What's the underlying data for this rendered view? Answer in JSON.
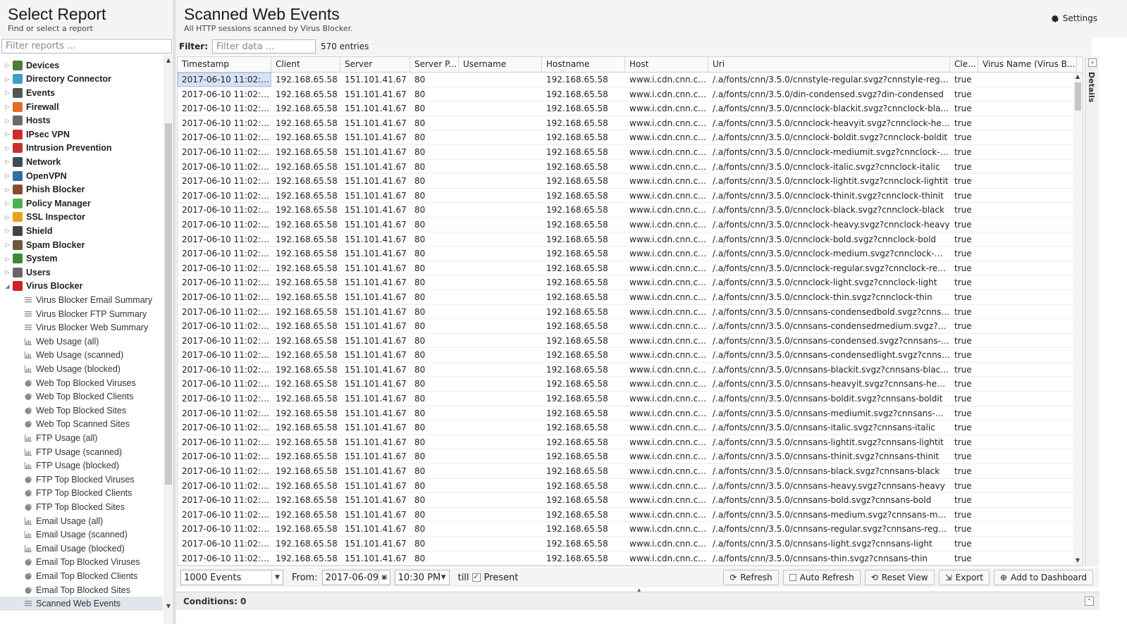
{
  "left": {
    "title": "Select Report",
    "subtitle": "Find or select a report",
    "filter_placeholder": "Filter reports ...",
    "tree": [
      {
        "label": "Devices",
        "type": "category",
        "expanded": false,
        "color": "#4a7d3a"
      },
      {
        "label": "Directory Connector",
        "type": "category",
        "expanded": false,
        "color": "#3aa0c8"
      },
      {
        "label": "Events",
        "type": "category",
        "expanded": false,
        "color": "#555555"
      },
      {
        "label": "Firewall",
        "type": "category",
        "expanded": false,
        "color": "#e26b2a"
      },
      {
        "label": "Hosts",
        "type": "category",
        "expanded": false,
        "color": "#6a6a6a"
      },
      {
        "label": "IPsec VPN",
        "type": "category",
        "expanded": false,
        "color": "#d22b2b"
      },
      {
        "label": "Intrusion Prevention",
        "type": "category",
        "expanded": false,
        "color": "#c8322a"
      },
      {
        "label": "Network",
        "type": "category",
        "expanded": false,
        "color": "#3c4c5c"
      },
      {
        "label": "OpenVPN",
        "type": "category",
        "expanded": false,
        "color": "#2f6fa0"
      },
      {
        "label": "Phish Blocker",
        "type": "category",
        "expanded": false,
        "color": "#8a4a2a"
      },
      {
        "label": "Policy Manager",
        "type": "category",
        "expanded": false,
        "color": "#4caf50"
      },
      {
        "label": "SSL Inspector",
        "type": "category",
        "expanded": false,
        "color": "#e8a020"
      },
      {
        "label": "Shield",
        "type": "category",
        "expanded": false,
        "color": "#444444"
      },
      {
        "label": "Spam Blocker",
        "type": "category",
        "expanded": false,
        "color": "#6d5a3a"
      },
      {
        "label": "System",
        "type": "category",
        "expanded": false,
        "color": "#3a8a3a"
      },
      {
        "label": "Users",
        "type": "category",
        "expanded": false,
        "color": "#666666"
      },
      {
        "label": "Virus Blocker",
        "type": "category",
        "expanded": true,
        "color": "#d0202a"
      },
      {
        "label": "Virus Blocker Email Summary",
        "type": "text"
      },
      {
        "label": "Virus Blocker FTP Summary",
        "type": "text"
      },
      {
        "label": "Virus Blocker Web Summary",
        "type": "text"
      },
      {
        "label": "Web Usage (all)",
        "type": "bar"
      },
      {
        "label": "Web Usage (scanned)",
        "type": "bar"
      },
      {
        "label": "Web Usage (blocked)",
        "type": "bar"
      },
      {
        "label": "Web Top Blocked Viruses",
        "type": "pie"
      },
      {
        "label": "Web Top Blocked Clients",
        "type": "pie"
      },
      {
        "label": "Web Top Blocked Sites",
        "type": "pie"
      },
      {
        "label": "Web Top Scanned Sites",
        "type": "pie"
      },
      {
        "label": "FTP Usage (all)",
        "type": "bar"
      },
      {
        "label": "FTP Usage (scanned)",
        "type": "bar"
      },
      {
        "label": "FTP Usage (blocked)",
        "type": "bar"
      },
      {
        "label": "FTP Top Blocked Viruses",
        "type": "pie"
      },
      {
        "label": "FTP Top Blocked Clients",
        "type": "pie"
      },
      {
        "label": "FTP Top Blocked Sites",
        "type": "pie"
      },
      {
        "label": "Email Usage (all)",
        "type": "bar"
      },
      {
        "label": "Email Usage (scanned)",
        "type": "bar"
      },
      {
        "label": "Email Usage (blocked)",
        "type": "bar"
      },
      {
        "label": "Email Top Blocked Viruses",
        "type": "pie"
      },
      {
        "label": "Email Top Blocked Clients",
        "type": "pie"
      },
      {
        "label": "Email Top Blocked Sites",
        "type": "pie"
      },
      {
        "label": "Scanned Web Events",
        "type": "list",
        "selected": true
      }
    ]
  },
  "main": {
    "title": "Scanned Web Events",
    "subtitle": "All HTTP sessions scanned by Virus Blocker.",
    "settings_label": "Settings",
    "filter_label": "Filter:",
    "filter_placeholder": "Filter data ...",
    "entries": "570 entries",
    "details_label": "Details"
  },
  "grid": {
    "columns": [
      "Timestamp",
      "Client",
      "Server",
      "Server P...",
      "Username",
      "Hostname",
      "Host",
      "Uri",
      "Cle...",
      "Virus Name (Virus B..."
    ],
    "rows": [
      [
        "2017-06-10 11:02:5...",
        "192.168.65.58",
        "151.101.41.67",
        "80",
        "",
        "192.168.65.58",
        "www.i.cdn.cnn.co...",
        "/.a/fonts/cnn/3.5.0/cnnstyle-regular.svgz?cnnstyle-regular",
        "true",
        ""
      ],
      [
        "2017-06-10 11:02:5...",
        "192.168.65.58",
        "151.101.41.67",
        "80",
        "",
        "192.168.65.58",
        "www.i.cdn.cnn.co...",
        "/.a/fonts/cnn/3.5.0/din-condensed.svgz?din-condensed",
        "true",
        ""
      ],
      [
        "2017-06-10 11:02:5...",
        "192.168.65.58",
        "151.101.41.67",
        "80",
        "",
        "192.168.65.58",
        "www.i.cdn.cnn.co...",
        "/.a/fonts/cnn/3.5.0/cnnclock-blackit.svgz?cnnclock-blackit",
        "true",
        ""
      ],
      [
        "2017-06-10 11:02:5...",
        "192.168.65.58",
        "151.101.41.67",
        "80",
        "",
        "192.168.65.58",
        "www.i.cdn.cnn.co...",
        "/.a/fonts/cnn/3.5.0/cnnclock-heavyit.svgz?cnnclock-heavyit",
        "true",
        ""
      ],
      [
        "2017-06-10 11:02:5...",
        "192.168.65.58",
        "151.101.41.67",
        "80",
        "",
        "192.168.65.58",
        "www.i.cdn.cnn.co...",
        "/.a/fonts/cnn/3.5.0/cnnclock-boldit.svgz?cnnclock-boldit",
        "true",
        ""
      ],
      [
        "2017-06-10 11:02:5...",
        "192.168.65.58",
        "151.101.41.67",
        "80",
        "",
        "192.168.65.58",
        "www.i.cdn.cnn.co...",
        "/.a/fonts/cnn/3.5.0/cnnclock-mediumit.svgz?cnnclock-med...",
        "true",
        ""
      ],
      [
        "2017-06-10 11:02:5...",
        "192.168.65.58",
        "151.101.41.67",
        "80",
        "",
        "192.168.65.58",
        "www.i.cdn.cnn.co...",
        "/.a/fonts/cnn/3.5.0/cnnclock-italic.svgz?cnnclock-italic",
        "true",
        ""
      ],
      [
        "2017-06-10 11:02:5...",
        "192.168.65.58",
        "151.101.41.67",
        "80",
        "",
        "192.168.65.58",
        "www.i.cdn.cnn.co...",
        "/.a/fonts/cnn/3.5.0/cnnclock-lightit.svgz?cnnclock-lightit",
        "true",
        ""
      ],
      [
        "2017-06-10 11:02:5...",
        "192.168.65.58",
        "151.101.41.67",
        "80",
        "",
        "192.168.65.58",
        "www.i.cdn.cnn.co...",
        "/.a/fonts/cnn/3.5.0/cnnclock-thinit.svgz?cnnclock-thinit",
        "true",
        ""
      ],
      [
        "2017-06-10 11:02:5...",
        "192.168.65.58",
        "151.101.41.67",
        "80",
        "",
        "192.168.65.58",
        "www.i.cdn.cnn.co...",
        "/.a/fonts/cnn/3.5.0/cnnclock-black.svgz?cnnclock-black",
        "true",
        ""
      ],
      [
        "2017-06-10 11:02:5...",
        "192.168.65.58",
        "151.101.41.67",
        "80",
        "",
        "192.168.65.58",
        "www.i.cdn.cnn.co...",
        "/.a/fonts/cnn/3.5.0/cnnclock-heavy.svgz?cnnclock-heavy",
        "true",
        ""
      ],
      [
        "2017-06-10 11:02:5...",
        "192.168.65.58",
        "151.101.41.67",
        "80",
        "",
        "192.168.65.58",
        "www.i.cdn.cnn.co...",
        "/.a/fonts/cnn/3.5.0/cnnclock-bold.svgz?cnnclock-bold",
        "true",
        ""
      ],
      [
        "2017-06-10 11:02:5...",
        "192.168.65.58",
        "151.101.41.67",
        "80",
        "",
        "192.168.65.58",
        "www.i.cdn.cnn.co...",
        "/.a/fonts/cnn/3.5.0/cnnclock-medium.svgz?cnnclock-mediu...",
        "true",
        ""
      ],
      [
        "2017-06-10 11:02:5...",
        "192.168.65.58",
        "151.101.41.67",
        "80",
        "",
        "192.168.65.58",
        "www.i.cdn.cnn.co...",
        "/.a/fonts/cnn/3.5.0/cnnclock-regular.svgz?cnnclock-regular",
        "true",
        ""
      ],
      [
        "2017-06-10 11:02:5...",
        "192.168.65.58",
        "151.101.41.67",
        "80",
        "",
        "192.168.65.58",
        "www.i.cdn.cnn.co...",
        "/.a/fonts/cnn/3.5.0/cnnclock-light.svgz?cnnclock-light",
        "true",
        ""
      ],
      [
        "2017-06-10 11:02:5...",
        "192.168.65.58",
        "151.101.41.67",
        "80",
        "",
        "192.168.65.58",
        "www.i.cdn.cnn.co...",
        "/.a/fonts/cnn/3.5.0/cnnclock-thin.svgz?cnnclock-thin",
        "true",
        ""
      ],
      [
        "2017-06-10 11:02:5...",
        "192.168.65.58",
        "151.101.41.67",
        "80",
        "",
        "192.168.65.58",
        "www.i.cdn.cnn.co...",
        "/.a/fonts/cnn/3.5.0/cnnsans-condensedbold.svgz?cnnsans...",
        "true",
        ""
      ],
      [
        "2017-06-10 11:02:4...",
        "192.168.65.58",
        "151.101.41.67",
        "80",
        "",
        "192.168.65.58",
        "www.i.cdn.cnn.co...",
        "/.a/fonts/cnn/3.5.0/cnnsans-condensedmedium.svgz?cnn...",
        "true",
        ""
      ],
      [
        "2017-06-10 11:02:4...",
        "192.168.65.58",
        "151.101.41.67",
        "80",
        "",
        "192.168.65.58",
        "www.i.cdn.cnn.co...",
        "/.a/fonts/cnn/3.5.0/cnnsans-condensed.svgz?cnnsans-con...",
        "true",
        ""
      ],
      [
        "2017-06-10 11:02:4...",
        "192.168.65.58",
        "151.101.41.67",
        "80",
        "",
        "192.168.65.58",
        "www.i.cdn.cnn.co...",
        "/.a/fonts/cnn/3.5.0/cnnsans-condensedlight.svgz?cnnsans-...",
        "true",
        ""
      ],
      [
        "2017-06-10 11:02:4...",
        "192.168.65.58",
        "151.101.41.67",
        "80",
        "",
        "192.168.65.58",
        "www.i.cdn.cnn.co...",
        "/.a/fonts/cnn/3.5.0/cnnsans-blackit.svgz?cnnsans-blackit",
        "true",
        ""
      ],
      [
        "2017-06-10 11:02:4...",
        "192.168.65.58",
        "151.101.41.67",
        "80",
        "",
        "192.168.65.58",
        "www.i.cdn.cnn.co...",
        "/.a/fonts/cnn/3.5.0/cnnsans-heavyit.svgz?cnnsans-heavyit",
        "true",
        ""
      ],
      [
        "2017-06-10 11:02:4...",
        "192.168.65.58",
        "151.101.41.67",
        "80",
        "",
        "192.168.65.58",
        "www.i.cdn.cnn.co...",
        "/.a/fonts/cnn/3.5.0/cnnsans-boldit.svgz?cnnsans-boldit",
        "true",
        ""
      ],
      [
        "2017-06-10 11:02:4...",
        "192.168.65.58",
        "151.101.41.67",
        "80",
        "",
        "192.168.65.58",
        "www.i.cdn.cnn.co...",
        "/.a/fonts/cnn/3.5.0/cnnsans-mediumit.svgz?cnnsans-med...",
        "true",
        ""
      ],
      [
        "2017-06-10 11:02:4...",
        "192.168.65.58",
        "151.101.41.67",
        "80",
        "",
        "192.168.65.58",
        "www.i.cdn.cnn.co...",
        "/.a/fonts/cnn/3.5.0/cnnsans-italic.svgz?cnnsans-italic",
        "true",
        ""
      ],
      [
        "2017-06-10 11:02:4...",
        "192.168.65.58",
        "151.101.41.67",
        "80",
        "",
        "192.168.65.58",
        "www.i.cdn.cnn.co...",
        "/.a/fonts/cnn/3.5.0/cnnsans-lightit.svgz?cnnsans-lightit",
        "true",
        ""
      ],
      [
        "2017-06-10 11:02:4...",
        "192.168.65.58",
        "151.101.41.67",
        "80",
        "",
        "192.168.65.58",
        "www.i.cdn.cnn.co...",
        "/.a/fonts/cnn/3.5.0/cnnsans-thinit.svgz?cnnsans-thinit",
        "true",
        ""
      ],
      [
        "2017-06-10 11:02:4...",
        "192.168.65.58",
        "151.101.41.67",
        "80",
        "",
        "192.168.65.58",
        "www.i.cdn.cnn.co...",
        "/.a/fonts/cnn/3.5.0/cnnsans-black.svgz?cnnsans-black",
        "true",
        ""
      ],
      [
        "2017-06-10 11:02:4...",
        "192.168.65.58",
        "151.101.41.67",
        "80",
        "",
        "192.168.65.58",
        "www.i.cdn.cnn.co...",
        "/.a/fonts/cnn/3.5.0/cnnsans-heavy.svgz?cnnsans-heavy",
        "true",
        ""
      ],
      [
        "2017-06-10 11:02:4...",
        "192.168.65.58",
        "151.101.41.67",
        "80",
        "",
        "192.168.65.58",
        "www.i.cdn.cnn.co...",
        "/.a/fonts/cnn/3.5.0/cnnsans-bold.svgz?cnnsans-bold",
        "true",
        ""
      ],
      [
        "2017-06-10 11:02:4...",
        "192.168.65.58",
        "151.101.41.67",
        "80",
        "",
        "192.168.65.58",
        "www.i.cdn.cnn.co...",
        "/.a/fonts/cnn/3.5.0/cnnsans-medium.svgz?cnnsans-mediu...",
        "true",
        ""
      ],
      [
        "2017-06-10 11:02:4...",
        "192.168.65.58",
        "151.101.41.67",
        "80",
        "",
        "192.168.65.58",
        "www.i.cdn.cnn.co...",
        "/.a/fonts/cnn/3.5.0/cnnsans-regular.svgz?cnnsans-regular",
        "true",
        ""
      ],
      [
        "2017-06-10 11:02:4...",
        "192.168.65.58",
        "151.101.41.67",
        "80",
        "",
        "192.168.65.58",
        "www.i.cdn.cnn.co...",
        "/.a/fonts/cnn/3.5.0/cnnsans-light.svgz?cnnsans-light",
        "true",
        ""
      ],
      [
        "2017-06-10 11:02:4...",
        "192.168.65.58",
        "151.101.41.67",
        "80",
        "",
        "192.168.65.58",
        "www.i.cdn.cnn.co...",
        "/.a/fonts/cnn/3.5.0/cnnsans-thin.svgz?cnnsans-thin",
        "true",
        ""
      ]
    ]
  },
  "toolbar": {
    "events_select": "1000 Events",
    "from_label": "From:",
    "from_date": "2017-06-09",
    "from_time": "10:30 PM",
    "till_label": "till",
    "present_label": "Present",
    "present_checked": true,
    "refresh_label": "Refresh",
    "auto_refresh_label": "Auto Refresh",
    "reset_view_label": "Reset View",
    "export_label": "Export",
    "add_dashboard_label": "Add to Dashboard"
  },
  "conditions": {
    "label": "Conditions: 0"
  }
}
